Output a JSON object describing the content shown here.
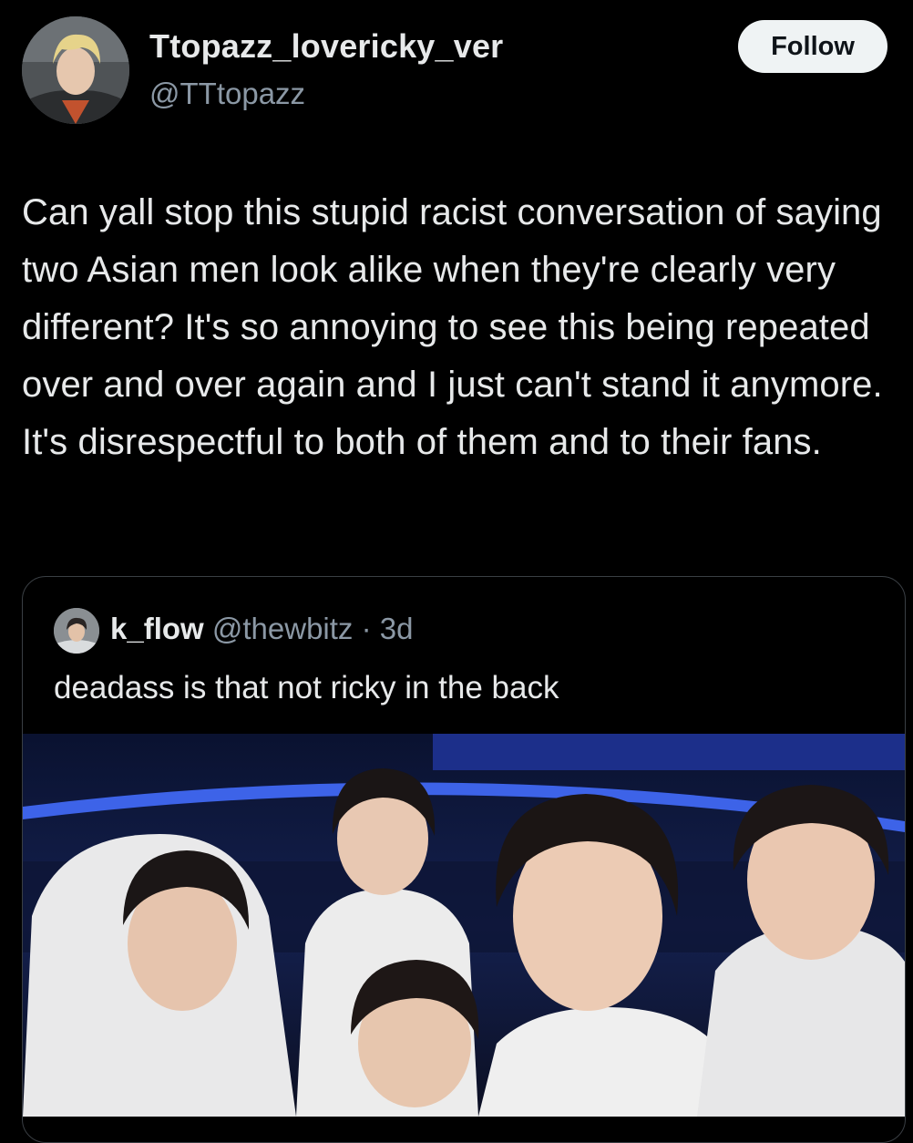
{
  "author": {
    "display_name": "Ttopazz_lovericky_ver",
    "handle": "@TTtopazz",
    "avatar_icon": "profile-photo"
  },
  "follow_button_label": "Follow",
  "tweet_text": "Can yall stop this stupid racist conversation of saying two Asian men look alike when they're clearly very different? It's so annoying to see this being repeated over and over again and I just can't stand it anymore. It's disrespectful to both of them and to their fans.",
  "quoted_tweet": {
    "display_name": "k_flow",
    "handle": "@thewbitz",
    "separator": " · ",
    "time": "3d",
    "text": "deadass is that not ricky in the back",
    "avatar_icon": "profile-photo",
    "media_icon": "group-photo"
  },
  "colors": {
    "background": "#000000",
    "primary_text": "#e7e9ea",
    "secondary_text": "#8b98a5",
    "button_bg": "#eff3f4",
    "card_border": "#3a3f44"
  }
}
